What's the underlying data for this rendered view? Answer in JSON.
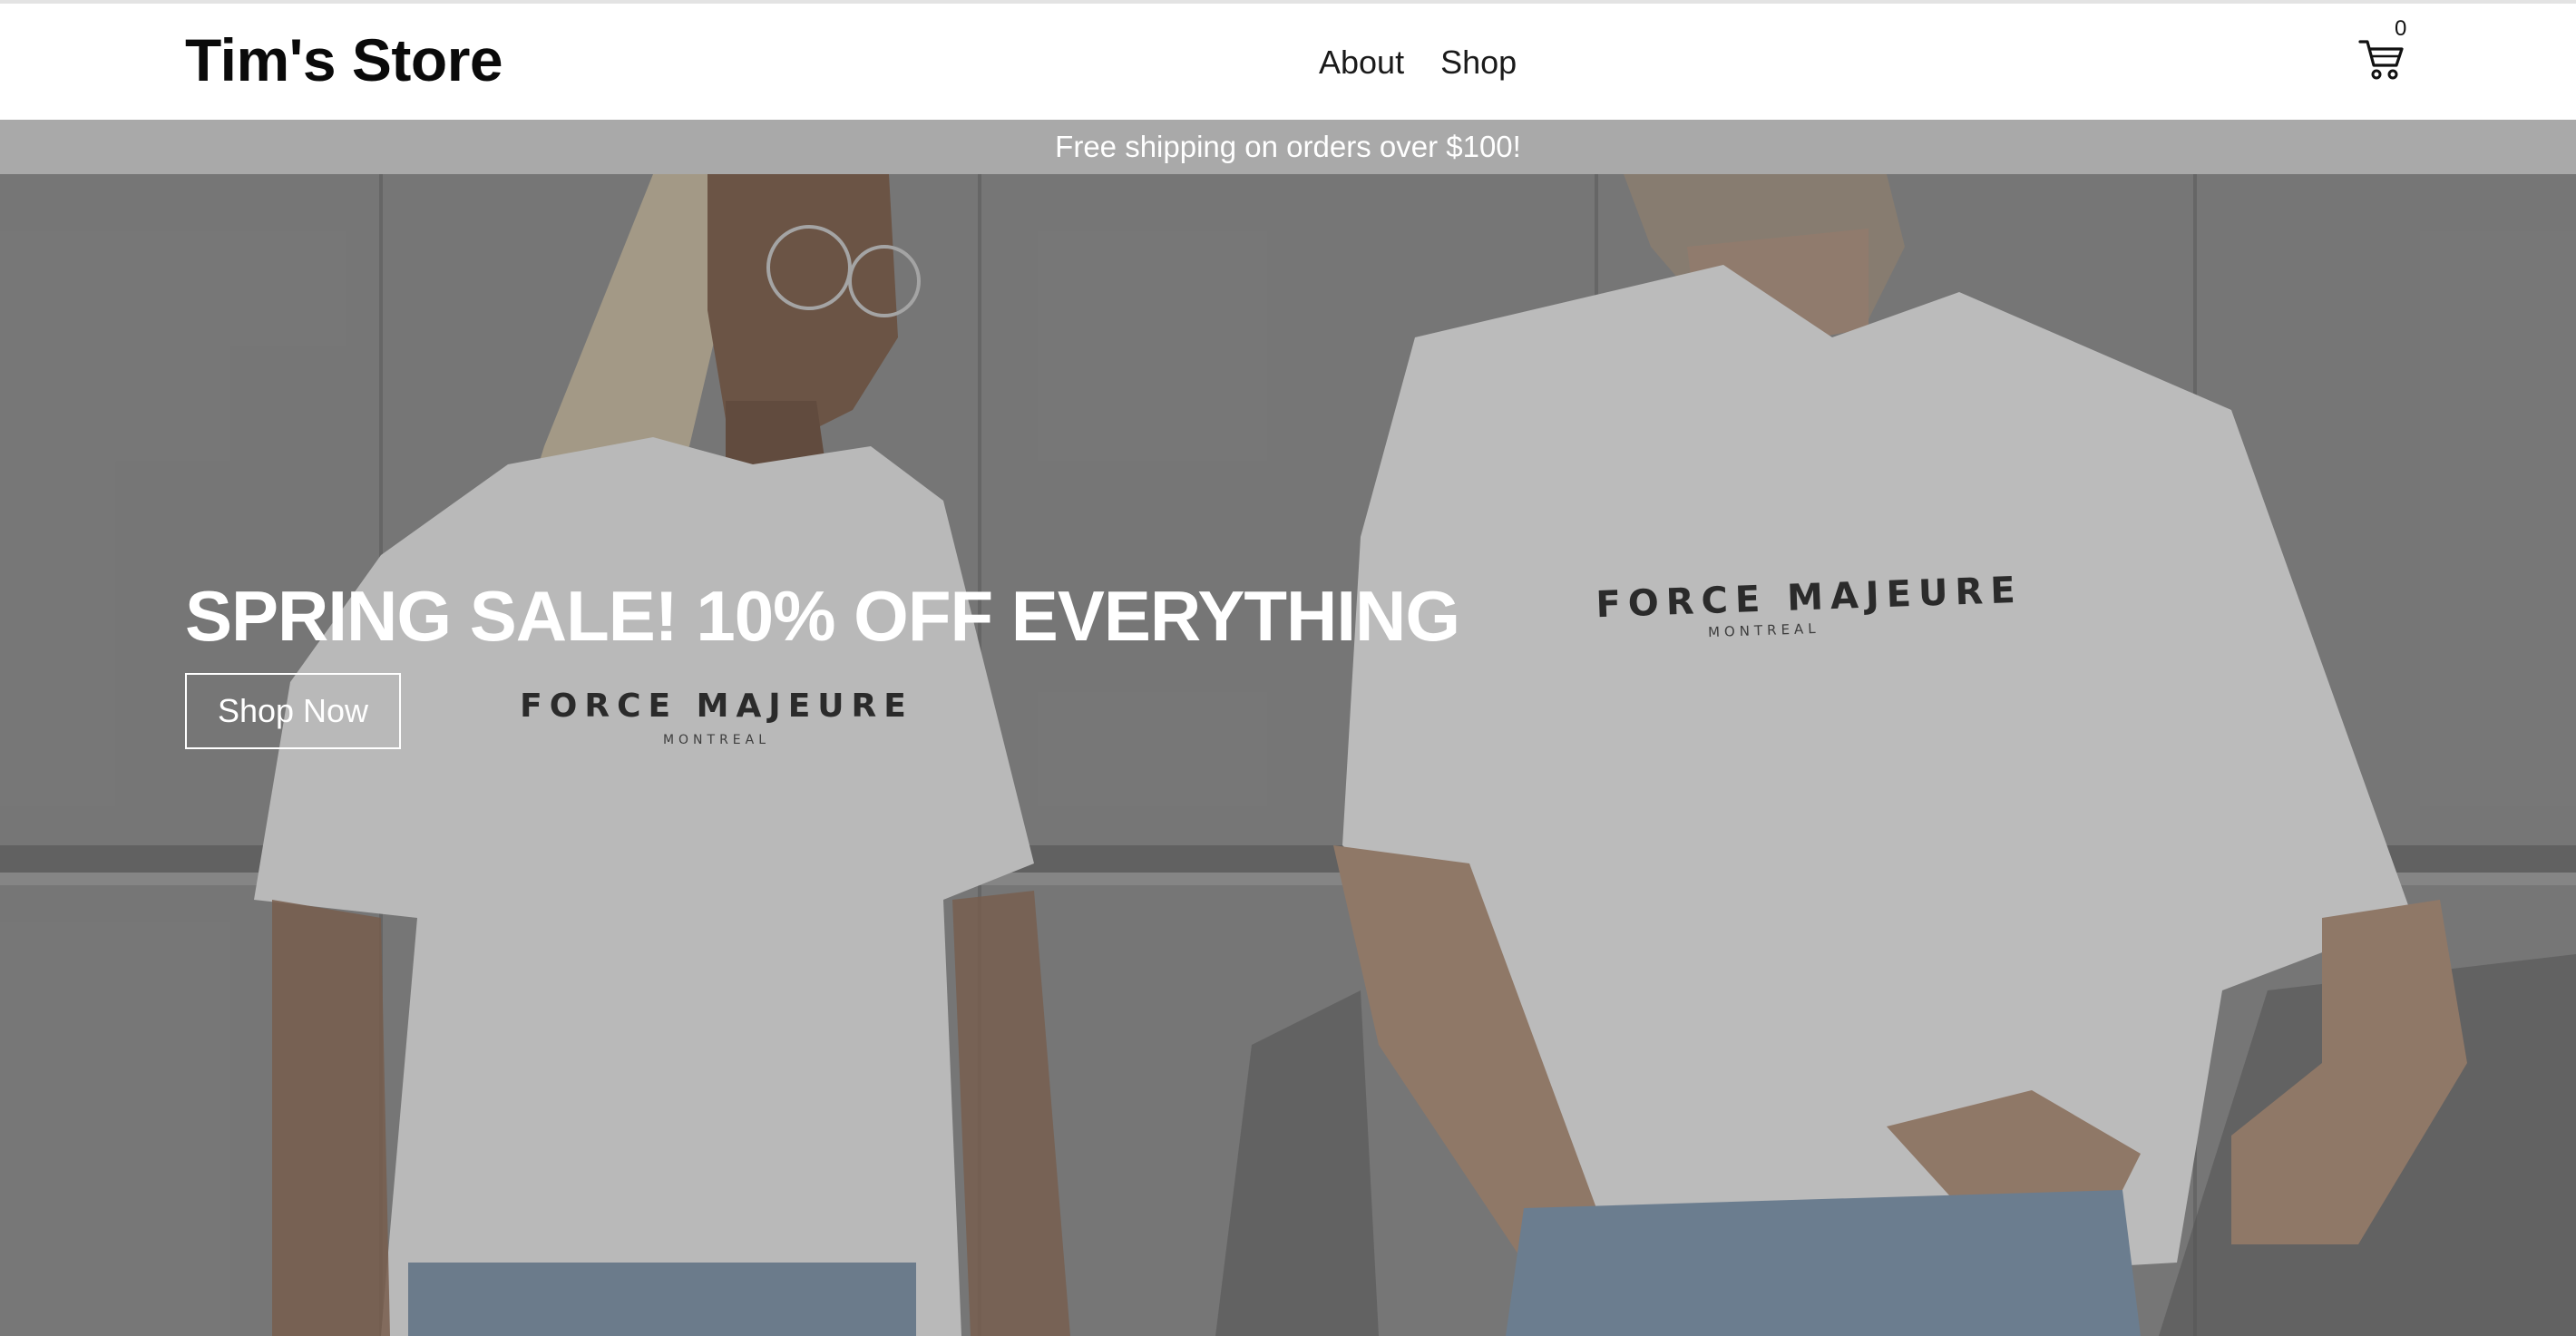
{
  "header": {
    "brand": "Tim's Store",
    "nav": [
      {
        "label": "About"
      },
      {
        "label": "Shop"
      }
    ],
    "cart": {
      "icon": "shopping-cart-icon",
      "count": "0"
    }
  },
  "promo": {
    "text": "Free shipping on orders over $100!"
  },
  "hero": {
    "headline": "SPRING SALE! 10% OFF EVERYTHING",
    "cta_label": "Shop Now",
    "shirt_print_left": "FORCE MAJEURE",
    "shirt_sub_left": "MONTREAL",
    "shirt_print_right": "FORCE MAJEURE",
    "shirt_sub_right": "MONTREAL"
  },
  "colors": {
    "promo_bar": "#a9a9a9",
    "hero_text": "#ffffff",
    "brand_text": "#0a0a0a"
  }
}
